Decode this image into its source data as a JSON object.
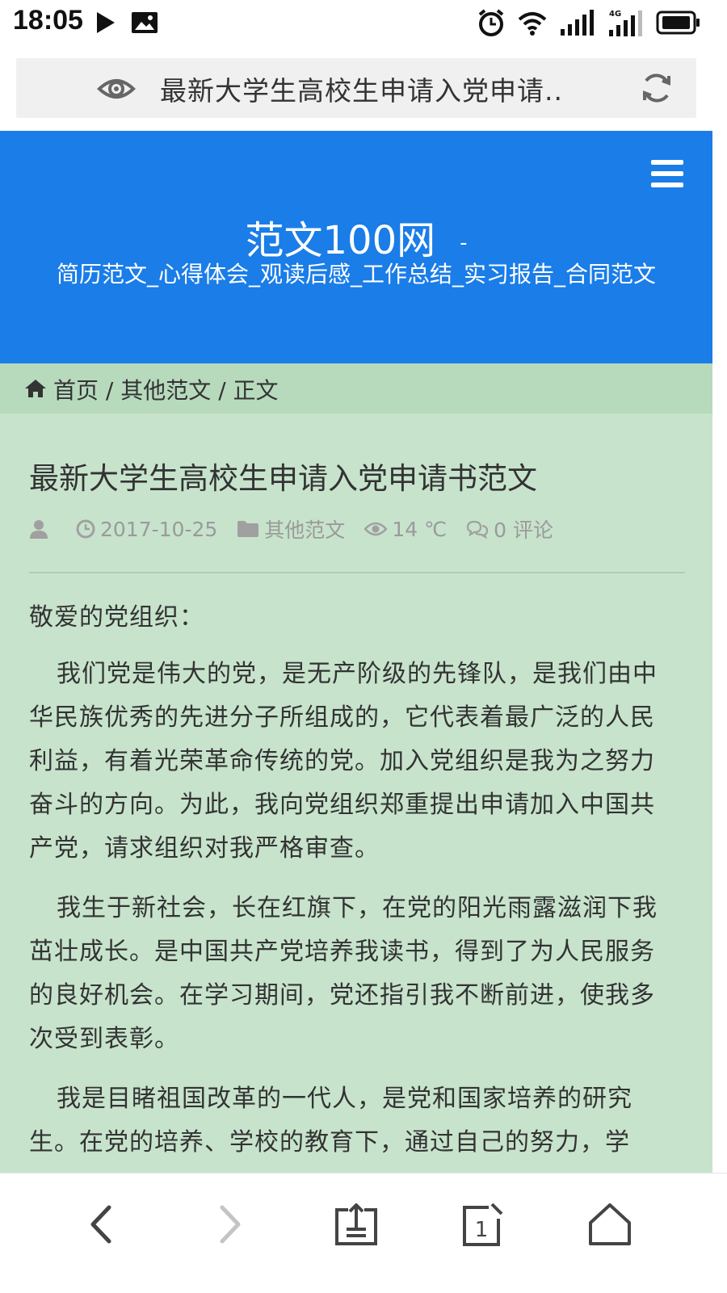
{
  "status_bar": {
    "time": "18:05",
    "network_label": "4G"
  },
  "url_bar": {
    "title": "最新大学生高校生申请入党申请.."
  },
  "site": {
    "title": "范文100网",
    "title_suffix": "-",
    "subtitle": "简历范文_心得体会_观读后感_工作总结_实习报告_合同范文"
  },
  "breadcrumb": {
    "items": [
      "首页",
      "其他范文",
      "正文"
    ],
    "separator": "/"
  },
  "article": {
    "title": "最新大学生高校生申请入党申请书范文",
    "date": "2017-10-25",
    "category": "其他范文",
    "views": "14 ℃",
    "comments": "0 评论",
    "greeting": "敬爱的党组织：",
    "paragraphs": [
      "我们党是伟大的党，是无产阶级的先锋队，是我们由中华民族优秀的先进分子所组成的，它代表着最广泛的人民利益，有着光荣革命传统的党。加入党组织是我为之努力奋斗的方向。为此，我向党组织郑重提出申请加入中国共产党，请求组织对我严格审查。",
      "我生于新社会，长在红旗下，在党的阳光雨露滋润下我茁壮成长。是中国共产党培养我读书，得到了为人民服务的良好机会。在学习期间，党还指引我不断前进，使我多次受到表彰。",
      "我是目睹祖国改革的一代人，是党和国家培养的研究生。在党的培养、学校的教育下，通过自己的努力，学"
    ]
  },
  "bottom_nav": {
    "tab_count": "1"
  },
  "colors": {
    "header_blue": "#1a7de8",
    "breadcrumb_green": "#b7dabd",
    "content_green": "#c7e3cc"
  }
}
